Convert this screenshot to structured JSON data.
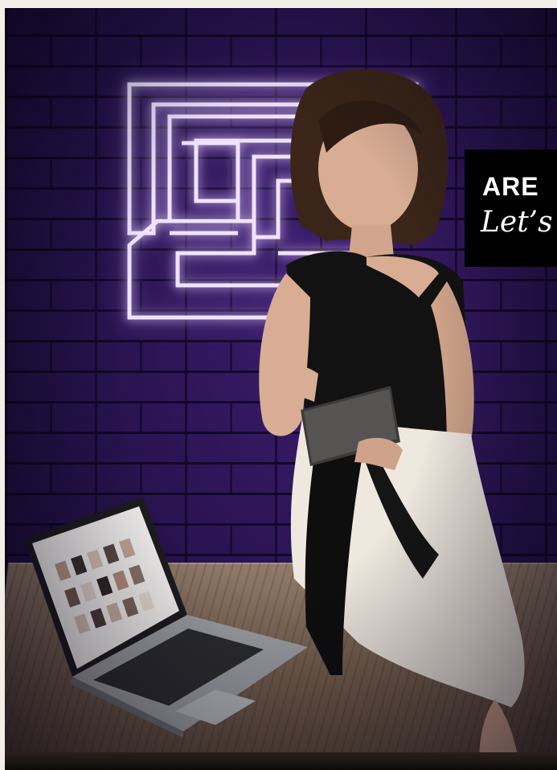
{
  "promo": {
    "heading": "ARE",
    "script": "Let’s"
  },
  "colors": {
    "wall": "#2a1452",
    "neon": "#e6d6ff",
    "promo_bg": "#000000",
    "frame_bg": "#f3efe6"
  },
  "icons": {
    "logo": "neon-maze-logo-icon",
    "tablet_logo": "apple-logo-icon"
  }
}
